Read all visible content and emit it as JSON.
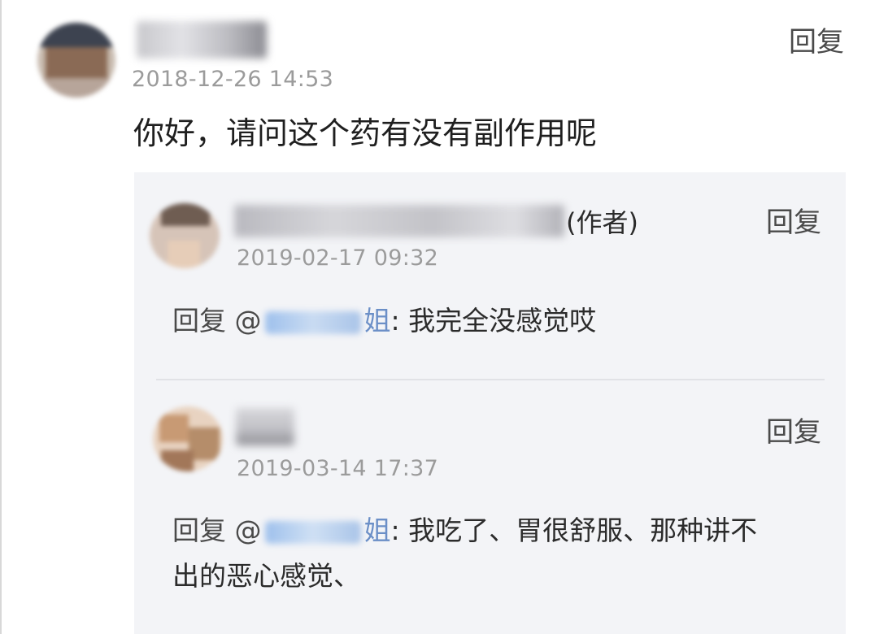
{
  "comment": {
    "timestamp": "2018-12-26 14:53",
    "reply_label": "回复",
    "text": "你好，请问这个药有没有副作用呢"
  },
  "replies": [
    {
      "author_suffix": "(作者)",
      "timestamp": "2019-02-17 09:32",
      "reply_label": "回复",
      "body_prefix": "回复 @",
      "mention_tail": "姐",
      "body_text": ": 我完全没感觉哎"
    },
    {
      "timestamp": "2019-03-14 17:37",
      "reply_label": "回复",
      "body_prefix": "回复 @",
      "mention_tail": "姐",
      "body_line1": ": 我吃了、胃很舒服、那种讲不",
      "body_line2": "出的恶心感觉、"
    }
  ],
  "colors": {
    "panel_bg": "#f3f4f7",
    "mention_blue": "#6b8fc7",
    "timestamp_gray": "#9b9b9b"
  }
}
